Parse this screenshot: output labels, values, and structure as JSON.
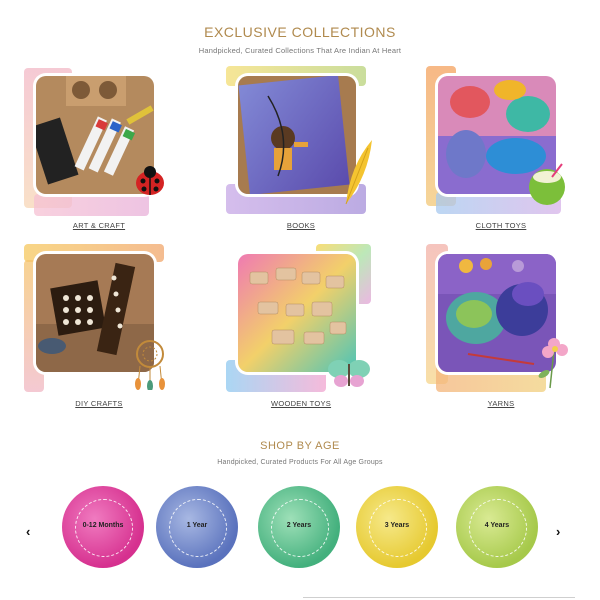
{
  "exclusive": {
    "title": "EXCLUSIVE COLLECTIONS",
    "subtitle": "Handpicked, Curated Collections That Are Indian At Heart",
    "items": [
      {
        "label": "ART & CRAFT"
      },
      {
        "label": "BOOKS"
      },
      {
        "label": "CLOTH TOYS"
      },
      {
        "label": "DIY CRAFTS"
      },
      {
        "label": "WOODEN TOYS"
      },
      {
        "label": "YARNS"
      }
    ]
  },
  "age": {
    "title": "SHOP BY AGE",
    "subtitle": "Handpicked, Curated Products For All Age Groups",
    "groups": [
      {
        "label": "0-12 Months",
        "color": "#e24aa1"
      },
      {
        "label": "1 Year",
        "color": "#6f86c5"
      },
      {
        "label": "2 Years",
        "color": "#5bbf8e"
      },
      {
        "label": "3 Years",
        "color": "#e6d34a"
      },
      {
        "label": "4 Years",
        "color": "#b7d35a"
      }
    ],
    "prev_icon": "chevron-left-icon",
    "next_icon": "chevron-right-icon"
  }
}
